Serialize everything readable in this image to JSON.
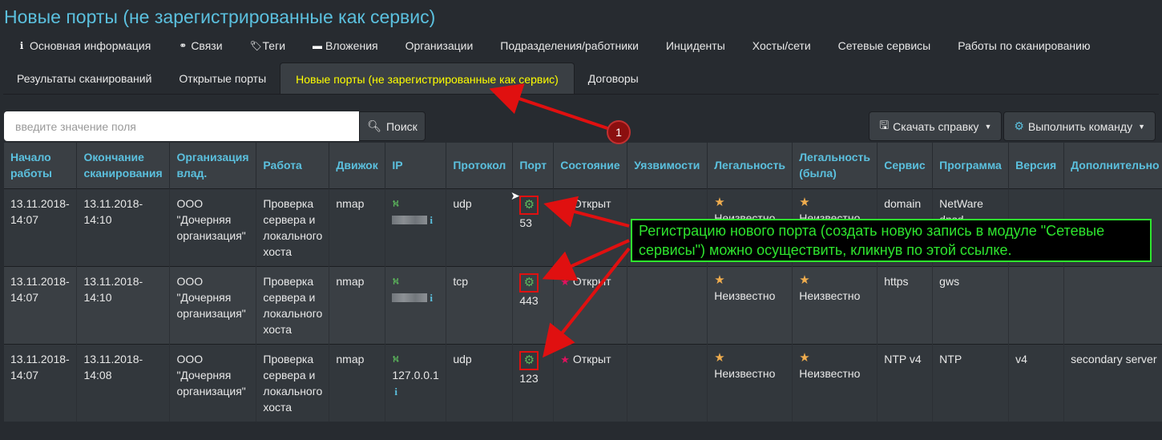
{
  "page": {
    "title": "Новые порты (не зарегистрированные как сервис)"
  },
  "tabs_row1": [
    {
      "label": "Основная информация",
      "icon": "info-icon"
    },
    {
      "label": "Связи",
      "icon": "link-icon"
    },
    {
      "label": "Теги",
      "icon": "tags-icon"
    },
    {
      "label": "Вложения",
      "icon": "folder-icon"
    },
    {
      "label": "Организации"
    },
    {
      "label": "Подразделения/работники"
    },
    {
      "label": "Инциденты"
    },
    {
      "label": "Хосты/сети"
    },
    {
      "label": "Сетевые сервисы"
    },
    {
      "label": "Работы по сканированию"
    }
  ],
  "tabs_row2": [
    {
      "label": "Результаты сканирований"
    },
    {
      "label": "Открытые порты"
    },
    {
      "label": "Новые порты (не зарегистрированные как сервис)",
      "active": true
    },
    {
      "label": "Договоры"
    }
  ],
  "search": {
    "placeholder": "введите значение поля",
    "button": "Поиск"
  },
  "toolbar": {
    "download": "Скачать справку",
    "execute": "Выполнить команду"
  },
  "table": {
    "headers": [
      "Начало работы",
      "Окончание сканирования",
      "Организация влад.",
      "Работа",
      "Движок",
      "IP",
      "Протокол",
      "Порт",
      "Состояние",
      "Уязвимости",
      "Легальность",
      "Легальность (была)",
      "Сервис",
      "Программа",
      "Версия",
      "Дополнительно"
    ],
    "rows": [
      {
        "start": "13.11.2018-14:07",
        "end": "13.11.2018-14:10",
        "org": "ООО \"Дочерняя организация\"",
        "job": "Проверка сервера и локального хоста",
        "engine": "nmap",
        "ip": "",
        "proto": "udp",
        "port": "53",
        "state": "Открыт",
        "vuln": "",
        "legal": "Неизвестно",
        "legal_was": "Неизвестно",
        "service": "domain",
        "program": "NetWare dnsd",
        "version": "",
        "extra": ""
      },
      {
        "start": "13.11.2018-14:07",
        "end": "13.11.2018-14:10",
        "org": "ООО \"Дочерняя организация\"",
        "job": "Проверка сервера и локального хоста",
        "engine": "nmap",
        "ip": "",
        "proto": "tcp",
        "port": "443",
        "state": "Открыт",
        "vuln": "",
        "legal": "Неизвестно",
        "legal_was": "Неизвестно",
        "service": "https",
        "program": "gws",
        "version": "",
        "extra": ""
      },
      {
        "start": "13.11.2018-14:07",
        "end": "13.11.2018-14:08",
        "org": "ООО \"Дочерняя организация\"",
        "job": "Проверка сервера и локального хоста",
        "engine": "nmap",
        "ip": "127.0.0.1",
        "proto": "udp",
        "port": "123",
        "state": "Открыт",
        "vuln": "",
        "legal": "Неизвестно",
        "legal_was": "Неизвестно",
        "service": "NTP v4",
        "program": "NTP",
        "version": "v4",
        "extra": "secondary server"
      }
    ]
  },
  "annotation": {
    "badge": "1",
    "callout": "Регистрацию нового порта (создать новую запись в модуле \"Сетевые сервисы\") можно осуществить, кликнув по этой ссылке."
  },
  "colors": {
    "background": "#272b30",
    "header_text": "#5bc0de",
    "active_tab_text": "#ffff00",
    "callout": "#2ee52e",
    "arrow": "#e01010"
  }
}
